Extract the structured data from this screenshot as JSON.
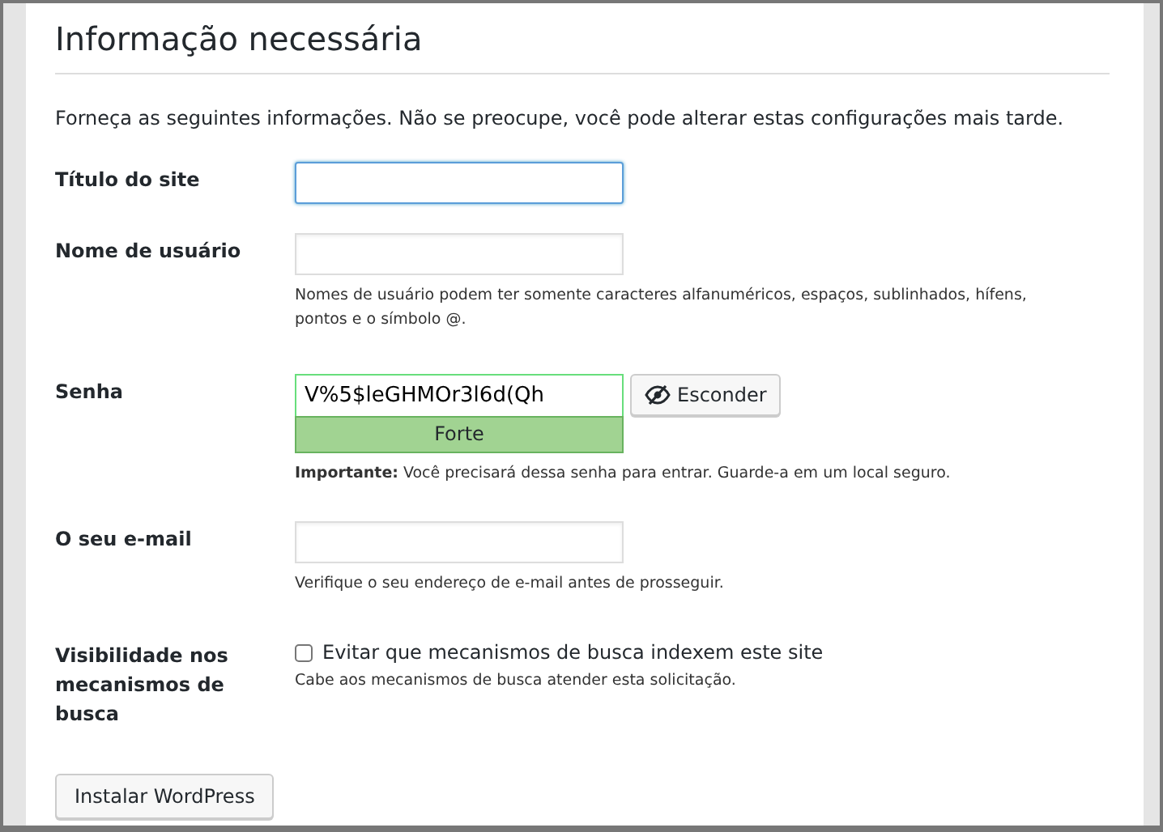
{
  "title": "Informação necessária",
  "intro": "Forneça as seguintes informações. Não se preocupe, você pode alterar estas configurações mais tarde.",
  "fields": [
    {
      "kind": "text",
      "label": "Título do site",
      "focused": true
    },
    {
      "kind": "text",
      "label": "Nome de usuário",
      "focused": false,
      "hint": "Nomes de usuário podem ter somente caracteres alfanuméricos, espaços, sublinhados, hífens, pontos e o símbolo @."
    },
    {
      "kind": "password",
      "label": "Senha",
      "value": "V%5$leGHMOr3l6d(Qh",
      "strength": "Forte",
      "toggle": "Esconder",
      "hint": "**Importante:** Você precisará dessa senha para entrar. Guarde-a em um local seguro."
    },
    {
      "kind": "text",
      "label": "O seu e-mail",
      "focused": false,
      "hint": "Verifique o seu endereço de e-mail antes de prosseguir."
    },
    {
      "kind": "checkbox",
      "label": "Visibilidade nos mecanismos de busca",
      "option": "Evitar que mecanismos de busca indexem este site",
      "checked": false,
      "hint": "Cabe aos mecanismos de busca atender esta solicitação."
    }
  ],
  "submit": "Instalar WordPress"
}
